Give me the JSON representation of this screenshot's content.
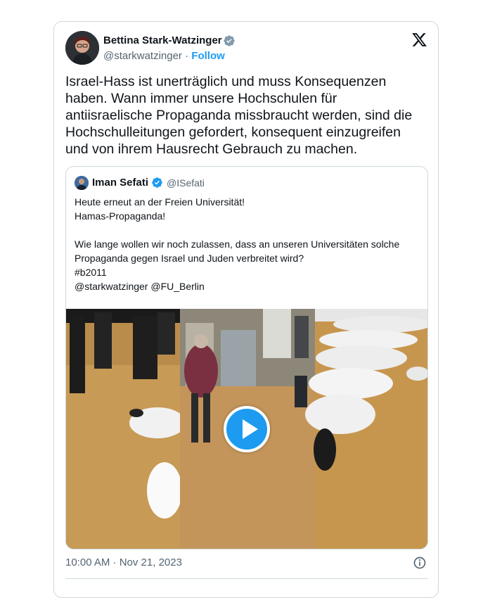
{
  "author": {
    "name": "Bettina Stark-Watzinger",
    "handle": "@starkwatzinger",
    "separator": "·",
    "follow_label": "Follow",
    "verified_color": "#829aab"
  },
  "tweet": {
    "text": "Israel-Hass ist unerträglich und muss Konsequenzen haben. Wann immer unsere Hochschulen für antiisraelische Propaganda missbraucht werden, sind die Hochschulleitungen gefordert, konsequent einzugreifen und von ihrem Hausrecht Gebrauch zu machen.",
    "timestamp": "10:00 AM · Nov 21, 2023"
  },
  "quote": {
    "name": "Iman Sefati",
    "handle": "@ISefati",
    "verified_color": "#1d9bf0",
    "text": "Heute erneut an der Freien Universität!\nHamas-Propaganda!\n\nWie lange wollen wir noch zulassen, dass an unseren Universitäten solche Propaganda gegen Israel und Juden verbreitet wird?\n#b2011\n@starkwatzinger  @FU_Berlin"
  },
  "icons": {
    "platform": "x-logo-icon",
    "info": "info-icon",
    "play": "play-icon"
  },
  "colors": {
    "accent": "#1d9bf0",
    "secondary_text": "#536471",
    "border": "#cfd9de"
  }
}
